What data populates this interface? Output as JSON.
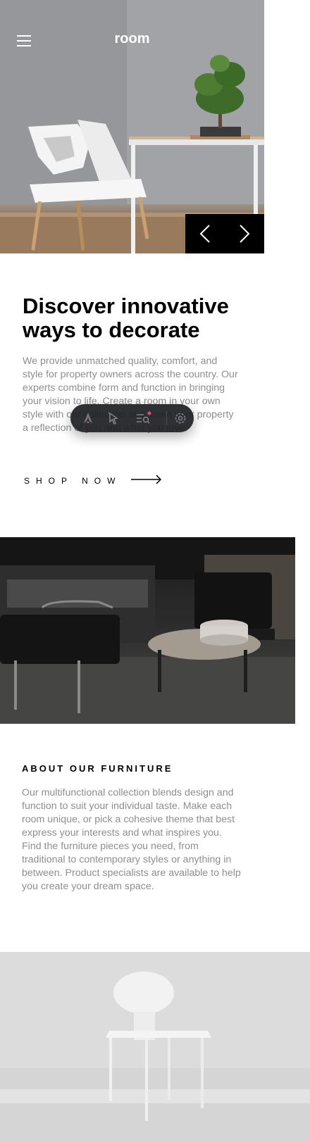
{
  "header": {
    "logo": "room",
    "menu_icon": "hamburger-menu-icon"
  },
  "slider": {
    "prev_label": "‹",
    "next_label": "›",
    "prev_icon": "chevron-left-icon",
    "next_icon": "chevron-right-icon"
  },
  "hero": {
    "title": "Discover innovative ways to decorate",
    "description": "We provide unmatched quality, comfort, and style for property owners across the country. Our experts combine form and function in bringing your vision to life. Create a room in your own style with our collection and make your property a reflection of you and what you love.",
    "cta_label": "SHOP NOW",
    "cta_icon": "arrow-right-icon"
  },
  "about": {
    "heading": "ABOUT OUR FURNITURE",
    "body": "Our multifunctional collection blends design and function to suit your individual taste. Make each room unique, or pick a cohesive theme that best express your interests and what inspires you. Find the furniture pieces you need, from traditional to contemporary styles or anything in between. Product specialists are available to help you create your dream space."
  },
  "toolbar": {
    "icons": [
      "astro-logo-icon",
      "cursor-select-icon",
      "audit-list-icon",
      "settings-gear-icon"
    ],
    "notification_color": "#e0455a"
  },
  "colors": {
    "text_dark": "#000000",
    "text_muted": "#8e8e8e",
    "slider_bg": "#000000",
    "toolbar_bg": "#1e1f22"
  }
}
